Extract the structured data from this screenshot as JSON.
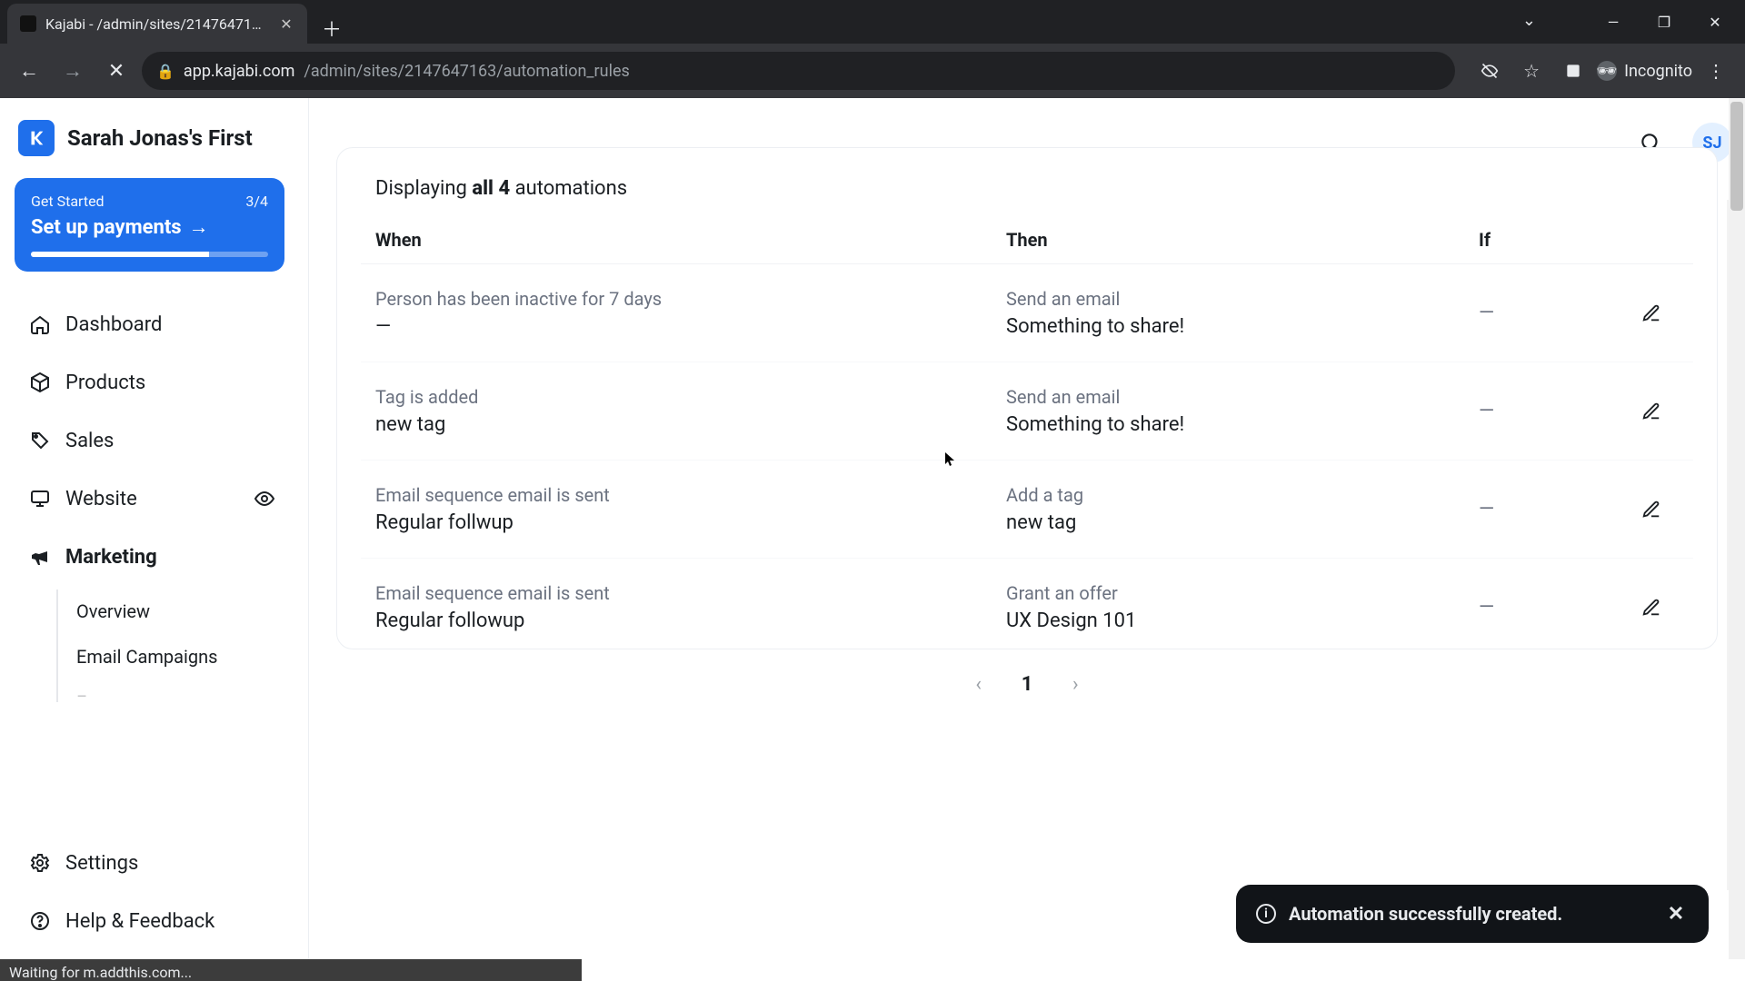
{
  "browser": {
    "tab_title": "Kajabi - /admin/sites/2147647163/automation_rules",
    "tab_title_truncated": "Kajabi - /admin/sites/2147647163…",
    "url_host": "app.kajabi.com",
    "url_path": "/admin/sites/2147647163/automation_rules",
    "incognito_label": "Incognito"
  },
  "header": {
    "site_name": "Sarah Jonas's First",
    "avatar_initials": "SJ"
  },
  "sidebar": {
    "get_started": {
      "eyebrow": "Get Started",
      "progress_text": "3/4",
      "title_label": "Set up payments"
    },
    "items": [
      {
        "label": "Dashboard",
        "icon": "home"
      },
      {
        "label": "Products",
        "icon": "cube"
      },
      {
        "label": "Sales",
        "icon": "tag"
      },
      {
        "label": "Website",
        "icon": "monitor",
        "eye": true
      },
      {
        "label": "Marketing",
        "icon": "megaphone",
        "active": true
      }
    ],
    "subnav": [
      {
        "label": "Overview"
      },
      {
        "label": "Email Campaigns"
      }
    ],
    "subnav_more_hint": "F",
    "footer": [
      {
        "label": "Settings",
        "icon": "gear"
      },
      {
        "label": "Help & Feedback",
        "icon": "help"
      }
    ]
  },
  "panel": {
    "displaying_prefix": "Displaying ",
    "displaying_count": "all 4",
    "displaying_suffix": " automations",
    "columns": {
      "when": "When",
      "then": "Then",
      "if_": "If"
    },
    "rows": [
      {
        "when_muted": "Person has been inactive for 7 days",
        "when_value": "—",
        "then_muted": "Send an email",
        "then_value": "Something to share!",
        "if_value": "—"
      },
      {
        "when_muted": "Tag is added",
        "when_value": "new tag",
        "then_muted": "Send an email",
        "then_value": "Something to share!",
        "if_value": "—"
      },
      {
        "when_muted": "Email sequence email is sent",
        "when_value": "Regular follwup",
        "then_muted": "Add a tag",
        "then_value": "new tag",
        "if_value": "—"
      },
      {
        "when_muted": "Email sequence email is sent",
        "when_value": "Regular followup",
        "then_muted": "Grant an offer",
        "then_value": "UX Design 101",
        "if_value": "—"
      }
    ],
    "pager": {
      "current": "1"
    }
  },
  "toast": {
    "message": "Automation successfully created."
  },
  "statusbar": {
    "text": "Waiting for m.addthis.com..."
  }
}
